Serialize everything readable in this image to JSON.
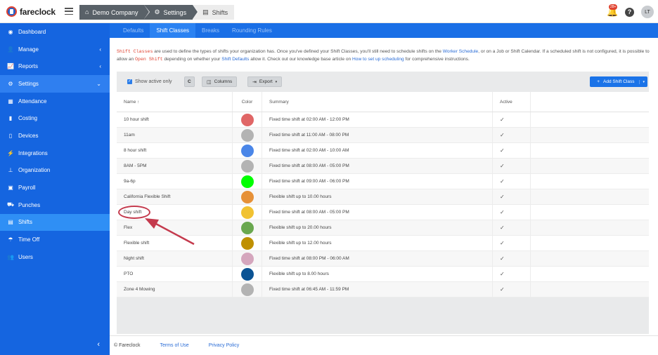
{
  "topbar": {
    "logo_text": "fareclock",
    "breadcrumbs": [
      "Demo Company",
      "Settings",
      "Shifts"
    ],
    "notifications_badge": "28+",
    "help_label": "?",
    "avatar_initials": "LT"
  },
  "sidebar": {
    "items": [
      {
        "label": "Dashboard",
        "icon": "dashboard-icon",
        "glyph": "◉"
      },
      {
        "label": "Manage",
        "icon": "person-icon",
        "glyph": "👤",
        "caret": "‹"
      },
      {
        "label": "Reports",
        "icon": "chart-icon",
        "glyph": "📈",
        "caret": "‹"
      },
      {
        "label": "Settings",
        "icon": "gear-icon",
        "glyph": "⚙",
        "caret": "⌄"
      },
      {
        "label": "Attendance",
        "icon": "calendar-icon",
        "glyph": "▦"
      },
      {
        "label": "Costing",
        "icon": "bar-chart-icon",
        "glyph": "▮"
      },
      {
        "label": "Devices",
        "icon": "tablet-icon",
        "glyph": "▯"
      },
      {
        "label": "Integrations",
        "icon": "plug-icon",
        "glyph": "⚡"
      },
      {
        "label": "Organization",
        "icon": "sitemap-icon",
        "glyph": "⊥"
      },
      {
        "label": "Payroll",
        "icon": "money-icon",
        "glyph": "▣"
      },
      {
        "label": "Punches",
        "icon": "truck-icon",
        "glyph": "⛟"
      },
      {
        "label": "Shifts",
        "icon": "clipboard-icon",
        "glyph": "▤"
      },
      {
        "label": "Time Off",
        "icon": "umbrella-icon",
        "glyph": "☂"
      },
      {
        "label": "Users",
        "icon": "users-icon",
        "glyph": "👥"
      }
    ],
    "collapse_glyph": "‹"
  },
  "subnav": {
    "tabs": [
      "Defaults",
      "Shift Classes",
      "Breaks",
      "Rounding Rules"
    ],
    "active": "Shift Classes"
  },
  "intro": {
    "code1": "Shift Classes",
    "t1": " are used to define the types of shifts your organization has. Once you've defined your Shift Classes, you'll still need to schedule shifts on the ",
    "link1": "Worker Schedule",
    "t2": ", or on a Job or Shift Calendar. If a scheduled shift is not configured, it is possible to allow an ",
    "code2": "Open Shift",
    "t3": " depending on whether your ",
    "link2": "Shift Defaults",
    "t4": " allow it. Check out our knowledge base article on ",
    "link3": "How to set up scheduling",
    "t5": " for comprehensive instructions."
  },
  "toolbar": {
    "show_active_label": "Show active only",
    "refresh_glyph": "C",
    "columns_label": "Columns",
    "export_label": "Export",
    "add_label": "Add Shift Class"
  },
  "table": {
    "headers": {
      "name": "Name ↑",
      "color": "Color",
      "summary": "Summary",
      "active": "Active"
    },
    "rows": [
      {
        "name": "10 hour shift",
        "color": "#e06666",
        "summary": "Fixed time shift at 02:00 AM - 12:00 PM",
        "active": "✓"
      },
      {
        "name": "11am",
        "color": "#b3b3b3",
        "summary": "Fixed time shift at 11:00 AM - 08:00 PM",
        "active": "✓"
      },
      {
        "name": "8 hour shift",
        "color": "#4a86e8",
        "summary": "Fixed time shift at 02:00 AM - 10:00 AM",
        "active": "✓"
      },
      {
        "name": "8AM - 5PM",
        "color": "#b3b3b3",
        "summary": "Fixed time shift at 08:00 AM - 05:00 PM",
        "active": "✓"
      },
      {
        "name": "9a-6p",
        "color": "#00ff00",
        "summary": "Fixed time shift at 09:00 AM - 06:00 PM",
        "active": "✓"
      },
      {
        "name": "California Flexible Shift",
        "color": "#e69138",
        "summary": "Flexible shift up to 10.00 hours",
        "active": "✓"
      },
      {
        "name": "Day shift",
        "color": "#f1c232",
        "summary": "Fixed time shift at 08:00 AM - 05:00 PM",
        "active": "✓"
      },
      {
        "name": "Flex",
        "color": "#6aa84f",
        "summary": "Flexible shift up to 20.00 hours",
        "active": "✓"
      },
      {
        "name": "Flexible shift",
        "color": "#bf9000",
        "summary": "Flexible shift up to 12.00 hours",
        "active": "✓"
      },
      {
        "name": "Night shift",
        "color": "#d5a6bd",
        "summary": "Fixed time shift at 08:00 PM - 06:00 AM",
        "active": "✓"
      },
      {
        "name": "PTO",
        "color": "#0b5394",
        "summary": "Flexible shift up to 8.00 hours",
        "active": "✓"
      },
      {
        "name": "Zone 4 Mowing",
        "color": "#b3b3b3",
        "summary": "Fixed time shift at 06:45 AM - 11:59 PM",
        "active": "✓"
      }
    ]
  },
  "footer": {
    "copyright": "© Fareclock",
    "terms": "Terms of Use",
    "privacy": "Privacy Policy"
  },
  "colors": {
    "sidebar": "#1565e0",
    "accent": "#1a73e8",
    "annotation": "#c43a4d"
  }
}
